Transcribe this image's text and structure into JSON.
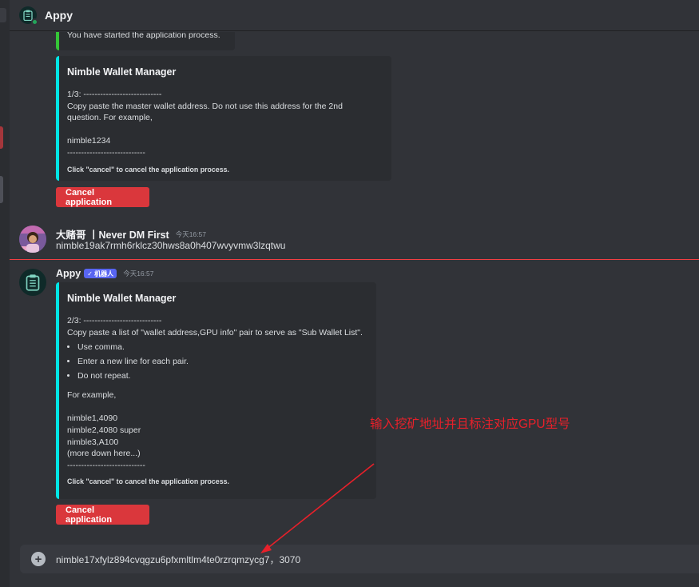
{
  "header": {
    "title": "Appy"
  },
  "messages": {
    "first_embed": {
      "text": "You have started the application process."
    },
    "embed1": {
      "title": "Nimble Wallet Manager",
      "body": "1/3: ----------------------------\nCopy paste the master wallet address. Do not use this address for the 2nd\nquestion. For example,\n\nnimble1234\n----------------------------",
      "footer": "Click \"cancel\" to cancel the application process."
    },
    "cancel_button_1": "Cancel application",
    "user_message": {
      "author": "大赌哥 丨Never DM First",
      "timestamp": "今天16:57",
      "text": "nimble19ak7rmh6rklcz30hws8a0h407wvyvmw3lzqtwu"
    },
    "bot_message": {
      "author": "Appy",
      "bot_tag": "✓ 机器人",
      "timestamp": "今天16:57"
    },
    "embed2": {
      "title": "Nimble Wallet Manager",
      "intro": "2/3: ----------------------------\nCopy paste a list of \"wallet address,GPU info\" pair to serve as \"Sub Wallet List\".",
      "bullets": [
        "Use comma.",
        "Enter a new line for each pair.",
        "Do not repeat."
      ],
      "examples": "For example,\n\nnimble1,4090\nnimble2,4080 super\nnimble3,A100\n(more down here...)\n----------------------------",
      "footer": "Click \"cancel\" to cancel the application process."
    },
    "cancel_button_2": "Cancel application"
  },
  "composer": {
    "value": "nimble17xfylz894cvqgzu6pfxmltlm4te0rzrqmzycg7，3070"
  },
  "annotation": {
    "text": "输入挖矿地址并且标注对应GPU型号",
    "color": "#e8202a"
  },
  "colors": {
    "embed_accent": "#00e5e5",
    "danger": "#da373c",
    "bot_tag": "#5865f2"
  }
}
